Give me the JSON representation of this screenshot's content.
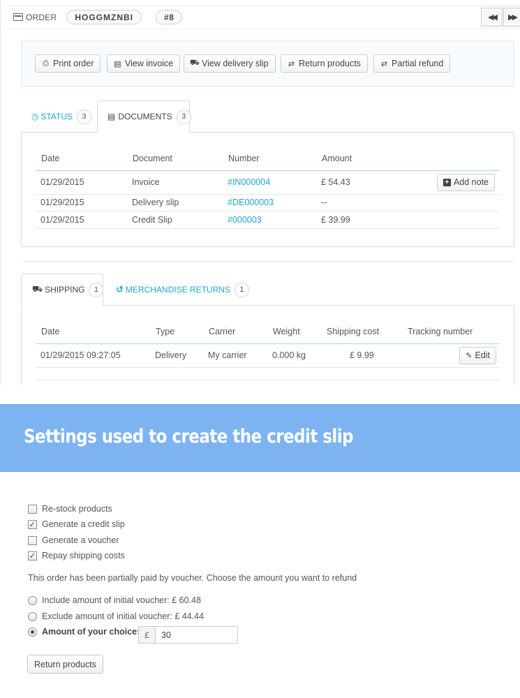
{
  "order": {
    "label": "ORDER",
    "reference": "HOGGMZNBI",
    "number": "#8",
    "nav_prev": "◀◀",
    "nav_next": "▶▶"
  },
  "toolbar": {
    "print_order": "Print order",
    "view_invoice": "View invoice",
    "view_delivery_slip": "View delivery slip",
    "return_products": "Return products",
    "partial_refund": "Partial refund"
  },
  "doc_tabs": {
    "status": {
      "label": "STATUS",
      "count": "3"
    },
    "documents": {
      "label": "DOCUMENTS",
      "count": "3"
    }
  },
  "documents_table": {
    "headers": [
      "Date",
      "Document",
      "Number",
      "Amount"
    ],
    "add_note_label": "Add note",
    "rows": [
      {
        "date": "01/29/2015",
        "document": "Invoice",
        "number": "#IN000004",
        "amount": "£ 54.43"
      },
      {
        "date": "01/29/2015",
        "document": "Delivery slip",
        "number": "#DE000003",
        "amount": "--"
      },
      {
        "date": "01/29/2015",
        "document": "Credit Slip",
        "number": "#000003",
        "amount": "£ 39.99"
      }
    ]
  },
  "ship_tabs": {
    "shipping": {
      "label": "SHIPPING",
      "count": "1"
    },
    "returns": {
      "label": "MERCHANDISE RETURNS",
      "count": "1"
    }
  },
  "shipping_table": {
    "headers": [
      "Date",
      "Type",
      "Carrier",
      "Weight",
      "Shipping cost",
      "Tracking number"
    ],
    "edit_label": "Edit",
    "rows": [
      {
        "date": "01/29/2015 09:27:05",
        "type": "Delivery",
        "carrier": "My carrier",
        "weight": "0.000 kg",
        "cost": "£ 9.99"
      }
    ]
  },
  "banner": {
    "title": "Settings used to create the credit slip"
  },
  "settings": {
    "restock": {
      "label": "Re-stock products",
      "checked": false
    },
    "credit_slip": {
      "label": "Generate a credit slip",
      "checked": true
    },
    "voucher": {
      "label": "Generate a voucher",
      "checked": false
    },
    "repay_shipping": {
      "label": "Repay shipping costs",
      "checked": true
    },
    "info": "This order has been partially paid by voucher. Choose the amount you want to refund",
    "include_voucher": "Include amount of initial voucher: £ 60.48",
    "exclude_voucher": "Exclude amount of initial voucher: £ 44.44",
    "custom_amount": "Amount of your choice:",
    "currency_symbol": "£",
    "custom_value": "30",
    "return_button": "Return products"
  },
  "colors": {
    "link": "#1ea6d4",
    "banner": "#7db3f1"
  },
  "icons": [
    "order-icon",
    "print-icon",
    "file-icon",
    "truck-icon",
    "exchange-icon",
    "clock-icon",
    "plus-square-icon",
    "pencil-icon",
    "undo-icon"
  ]
}
